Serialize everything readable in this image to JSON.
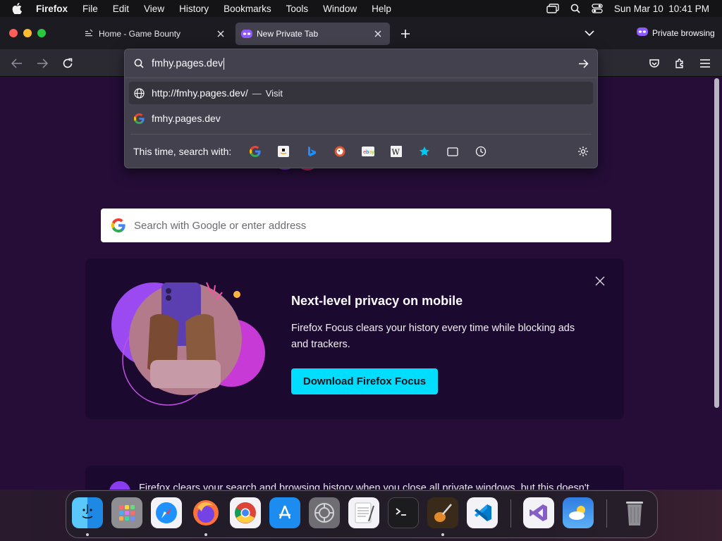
{
  "menubar": {
    "app": "Firefox",
    "items": [
      "File",
      "Edit",
      "View",
      "History",
      "Bookmarks",
      "Tools",
      "Window",
      "Help"
    ],
    "clock": "Sun Mar 10  10:41 PM"
  },
  "tabs": [
    {
      "label": "Home - Game Bounty",
      "icon": "page-icon",
      "active": false
    },
    {
      "label": "New Private Tab",
      "icon": "private-mask-icon",
      "active": true
    }
  ],
  "private_indicator": "Private browsing",
  "urlbar": {
    "value": "fmhy.pages.dev",
    "results": [
      {
        "text": "http://fmhy.pages.dev/",
        "separator": "—",
        "action": "Visit",
        "icon": "globe-icon"
      },
      {
        "text": "fmhy.pages.dev",
        "icon": "google-icon"
      }
    ],
    "search_with_label": "This time, search with:",
    "engines": [
      "google-icon",
      "amazon-icon",
      "bing-icon",
      "duckduckgo-icon",
      "ebay-icon",
      "wikipedia-icon",
      "bookmarks-star-icon",
      "tabs-icon",
      "history-icon"
    ]
  },
  "page": {
    "search_placeholder": "Search with Google or enter address",
    "promo": {
      "title": "Next-level privacy on mobile",
      "description": "Firefox Focus clears your history every time while blocking ads and trackers.",
      "button": "Download Firefox Focus"
    },
    "banner_text": "Firefox clears your search and browsing history when you close all private windows, but this doesn't"
  },
  "dock": [
    "finder-icon",
    "launchpad-icon",
    "safari-icon",
    "firefox-icon",
    "chrome-icon",
    "app-store-icon",
    "system-settings-icon",
    "textedit-icon",
    "terminal-icon",
    "garageband-icon",
    "vscode-icon",
    "visual-studio-icon",
    "weather-icon",
    "trash-icon"
  ],
  "colors": {
    "page_bg": "#250d38",
    "accent_button": "#00ddff",
    "panel_bg": "#42414d",
    "toolbar_bg": "#2b2a33"
  }
}
